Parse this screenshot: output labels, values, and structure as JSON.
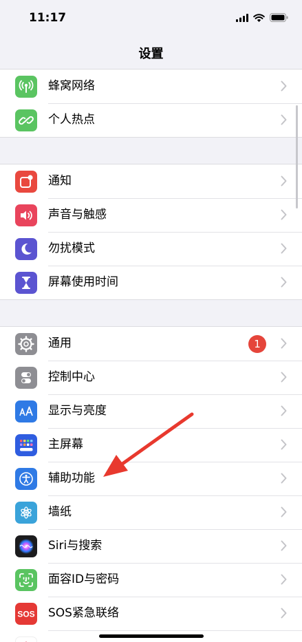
{
  "status_bar": {
    "time": "11:17"
  },
  "nav": {
    "title": "设置"
  },
  "groups": [
    {
      "items": [
        {
          "label": "蜂窝网络",
          "icon": "cellular-icon",
          "color": "#5ac461"
        },
        {
          "label": "个人热点",
          "icon": "hotspot-icon",
          "color": "#5ac461"
        }
      ]
    },
    {
      "items": [
        {
          "label": "通知",
          "icon": "notifications-icon",
          "color": "#e9493f"
        },
        {
          "label": "声音与触感",
          "icon": "sound-icon",
          "color": "#e9445c"
        },
        {
          "label": "勿扰模式",
          "icon": "moon-icon",
          "color": "#5b54d1"
        },
        {
          "label": "屏幕使用时间",
          "icon": "hourglass-icon",
          "color": "#5b54d1"
        }
      ]
    },
    {
      "items": [
        {
          "label": "通用",
          "icon": "gear-icon",
          "color": "#8e8e93",
          "badge": "1"
        },
        {
          "label": "控制中心",
          "icon": "toggles-icon",
          "color": "#8e8e93"
        },
        {
          "label": "显示与亮度",
          "icon": "display-icon",
          "color": "#2f7ae5"
        },
        {
          "label": "主屏幕",
          "icon": "home-screen-icon",
          "color": "#2f5de0"
        },
        {
          "label": "辅助功能",
          "icon": "accessibility-icon",
          "color": "#2f7ae5"
        },
        {
          "label": "墙纸",
          "icon": "wallpaper-icon",
          "color": "#3aa3da"
        },
        {
          "label": "Siri与搜索",
          "icon": "siri-icon",
          "color": "#1c1c1e"
        },
        {
          "label": "面容ID与密码",
          "icon": "faceid-icon",
          "color": "#5ac461"
        },
        {
          "label": "SOS紧急联络",
          "icon": "sos-icon",
          "color": "#e53935"
        }
      ]
    }
  ],
  "annotation": {
    "arrow_color": "#e8392e"
  }
}
